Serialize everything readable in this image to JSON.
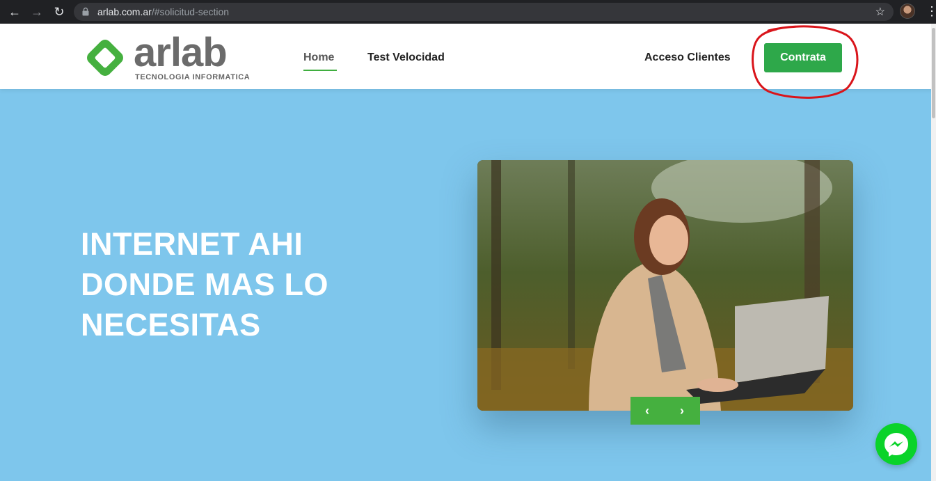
{
  "browser": {
    "url_host": "arlab.com.ar",
    "url_path": "/#solicitud-section",
    "back_icon": "arrow-left-icon",
    "forward_icon": "arrow-right-icon",
    "reload_icon": "reload-icon",
    "bookmark_icon": "star-icon"
  },
  "header": {
    "logo_word": "arlab",
    "logo_tagline": "TECNOLOGIA  INFORMATICA",
    "nav": [
      {
        "label": "Home",
        "active": true
      },
      {
        "label": "Test Velocidad"
      }
    ],
    "client_access": "Acceso Clientes",
    "cta_label": "Contrata"
  },
  "hero": {
    "title": "INTERNET AHI DONDE MAS LO NECESITAS",
    "prev_icon": "chevron-left-icon",
    "next_icon": "chevron-right-icon"
  },
  "colors": {
    "brand_green": "#3fae3f",
    "cta_green": "#2ea84a",
    "hero_bg": "#7ec6ec",
    "annotation_red": "#d9141a",
    "messenger_green": "#0ad32a"
  }
}
